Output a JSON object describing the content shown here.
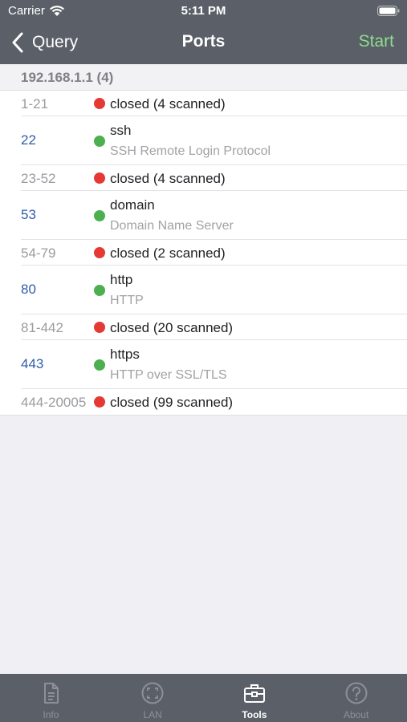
{
  "status_bar": {
    "carrier": "Carrier",
    "time": "5:11 PM"
  },
  "nav": {
    "back_label": "Query",
    "title": "Ports",
    "start_label": "Start"
  },
  "section": {
    "header": "192.168.1.1 (4)"
  },
  "rows": [
    {
      "port": "1-21",
      "state": "closed",
      "status": "closed (4 scanned)"
    },
    {
      "port": "22",
      "state": "open",
      "name": "ssh",
      "description": "SSH Remote Login Protocol"
    },
    {
      "port": "23-52",
      "state": "closed",
      "status": "closed (4 scanned)"
    },
    {
      "port": "53",
      "state": "open",
      "name": "domain",
      "description": "Domain Name Server"
    },
    {
      "port": "54-79",
      "state": "closed",
      "status": "closed (2 scanned)"
    },
    {
      "port": "80",
      "state": "open",
      "name": "http",
      "description": "HTTP"
    },
    {
      "port": "81-442",
      "state": "closed",
      "status": "closed (20 scanned)"
    },
    {
      "port": "443",
      "state": "open",
      "name": "https",
      "description": "HTTP over SSL/TLS"
    },
    {
      "port": "444-20005",
      "state": "closed",
      "status": "closed (99 scanned)"
    }
  ],
  "tabs": [
    {
      "label": "Info",
      "icon": "document-icon",
      "active": false
    },
    {
      "label": "LAN",
      "icon": "lan-scan-icon",
      "active": false
    },
    {
      "label": "Tools",
      "icon": "toolbox-icon",
      "active": true
    },
    {
      "label": "About",
      "icon": "question-icon",
      "active": false
    }
  ],
  "colors": {
    "bar_background": "#5b6068",
    "accent_start": "#8edc8e",
    "open_dot": "#4caf50",
    "closed_dot": "#e53935",
    "open_port": "#2e5da8"
  }
}
